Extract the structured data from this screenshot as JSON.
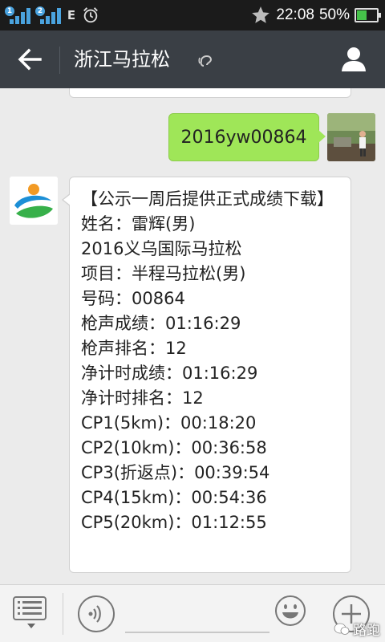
{
  "status_bar": {
    "sim1": "1",
    "sim2": "2",
    "network": "E",
    "time": "22:08",
    "battery_percent": "50%",
    "battery_level": 0.5,
    "icons": [
      "signal-icon",
      "alarm-icon",
      "star-icon",
      "battery-icon"
    ]
  },
  "header": {
    "title": "浙江马拉松",
    "icons": [
      "back-arrow-icon",
      "earpiece-icon",
      "profile-icon"
    ]
  },
  "chat": {
    "sent_message": "2016yw00864",
    "received_lines": [
      "【公示一周后提供正式成绩下载】",
      "姓名：雷辉(男)",
      "2016义乌国际马拉松",
      "项目：半程马拉松(男)",
      "号码：00864",
      "枪声成绩：01:16:29",
      "枪声排名：12",
      "净计时成绩：01:16:29",
      "净计时排名：12",
      "CP1(5km)：00:18:20",
      "CP2(10km)：00:36:58",
      "CP3(折返点)：00:39:54",
      "CP4(15km)：00:54:36",
      "CP5(20km)：01:12:55"
    ]
  },
  "input_bar": {
    "icons": [
      "menu-icon",
      "voice-icon",
      "emoji-icon",
      "plus-icon"
    ],
    "watermark": "路跑"
  },
  "colors": {
    "status_bar_bg": "#1b1b1b",
    "title_bar_bg": "#3a3f45",
    "chat_bg": "#ebebeb",
    "sent_bubble": "#9fe658",
    "signal_blue": "#4aa3df",
    "battery_green": "#46c24a"
  }
}
